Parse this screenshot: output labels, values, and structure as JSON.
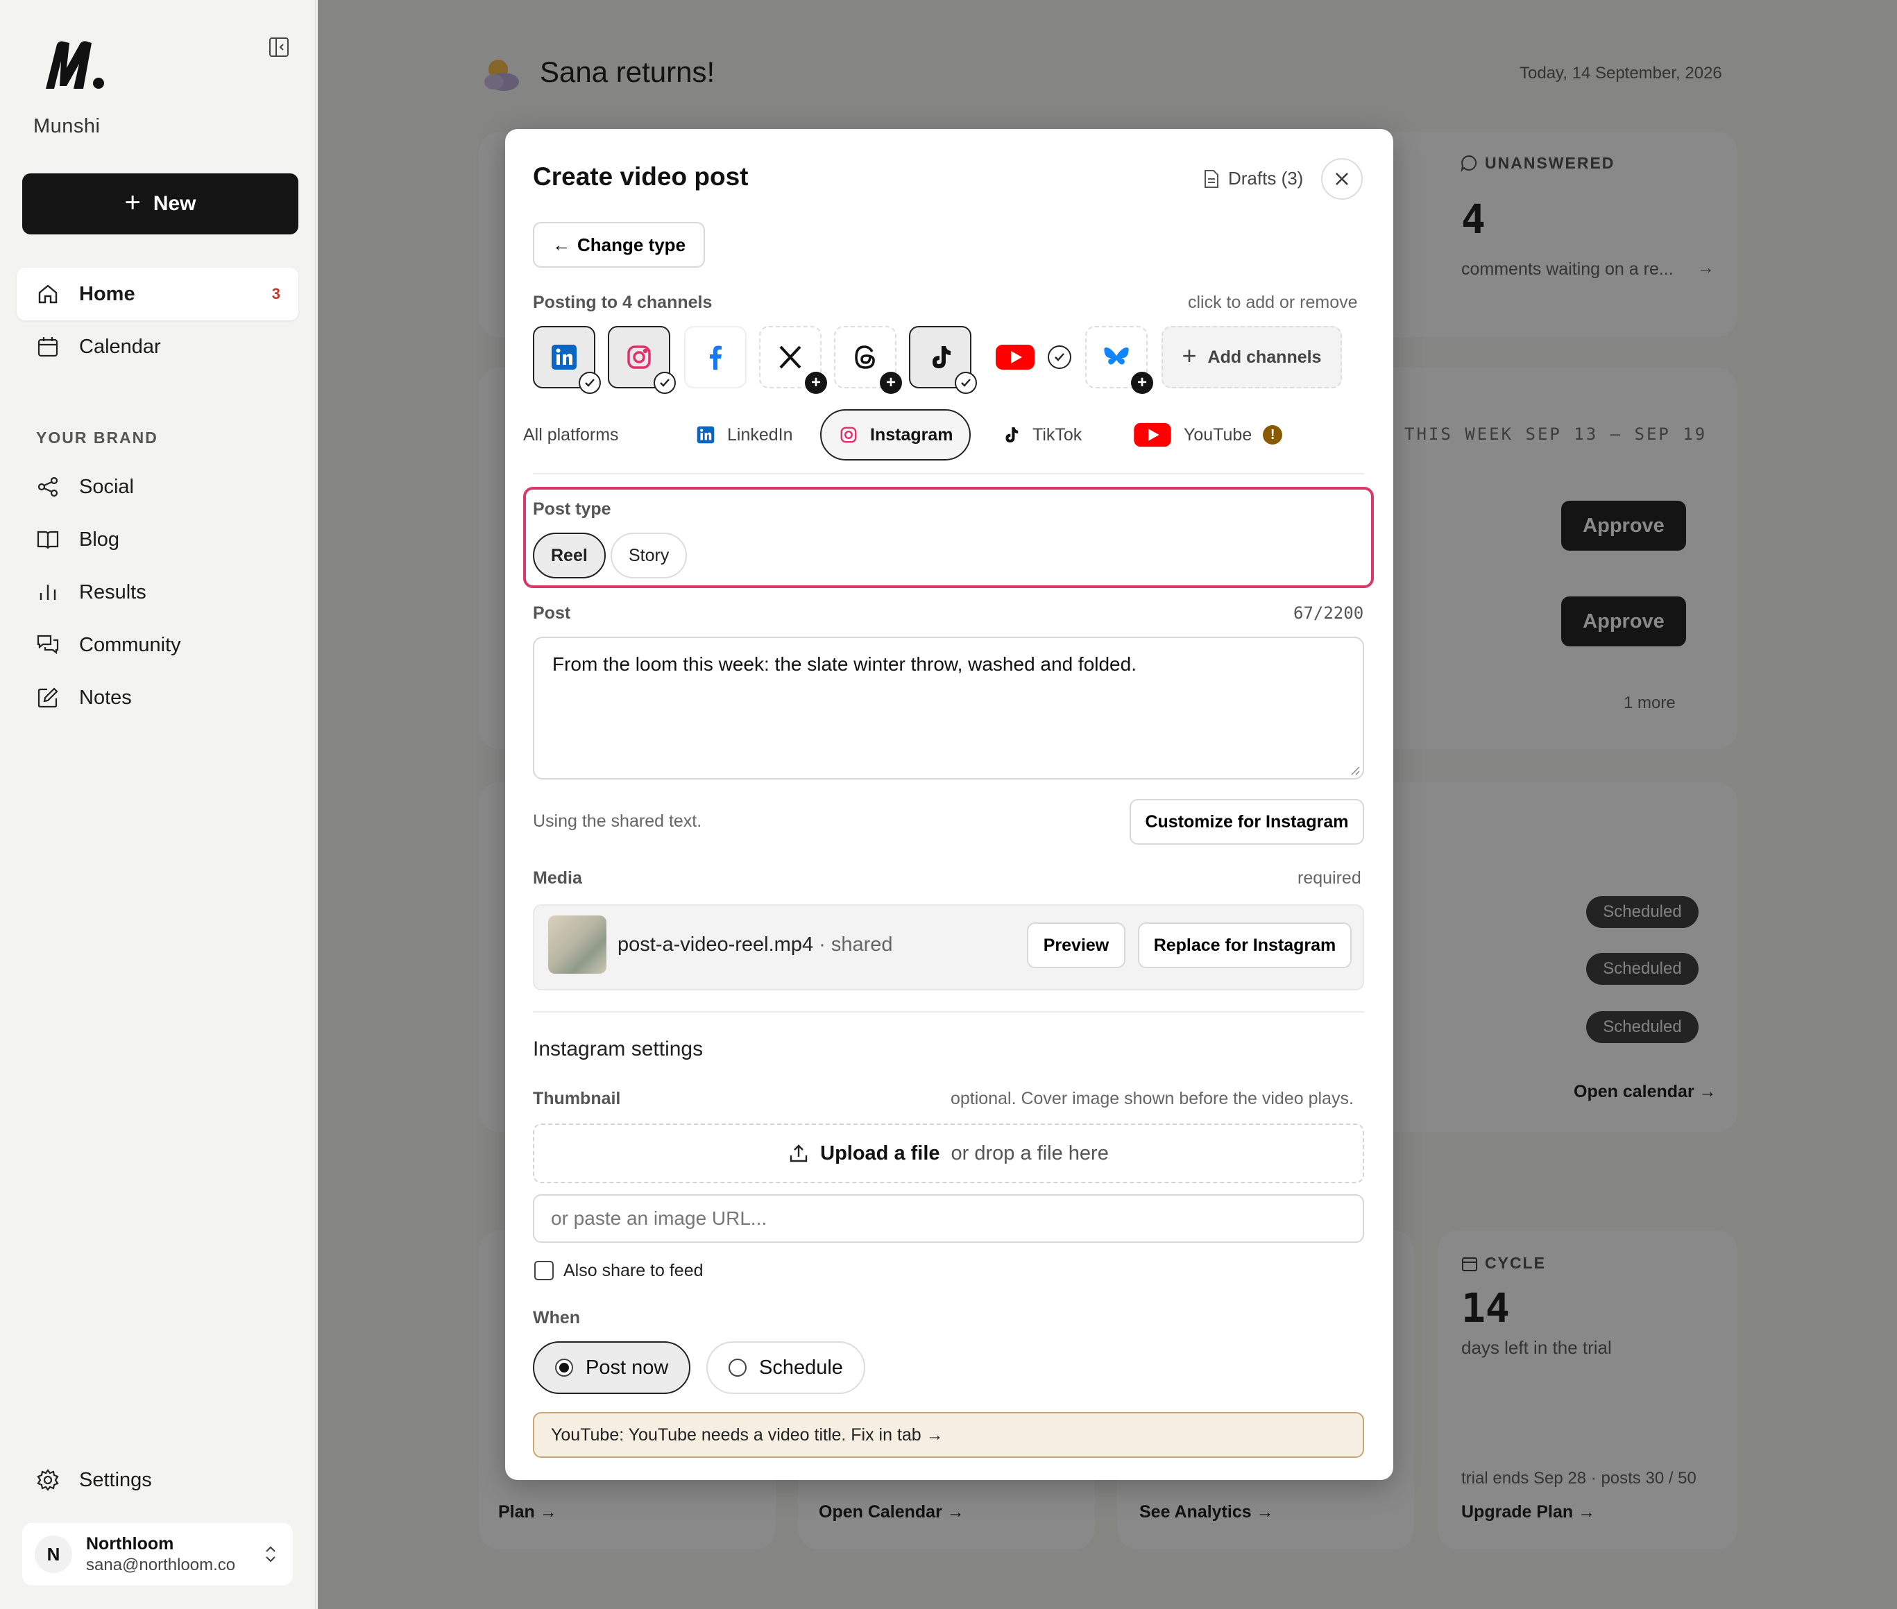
{
  "sidebar": {
    "brand": "Munshi",
    "new_label": "New",
    "nav": [
      {
        "label": "Home",
        "badge": "3"
      },
      {
        "label": "Calendar"
      }
    ],
    "section_label": "YOUR BRAND",
    "brand_nav": [
      {
        "label": "Social"
      },
      {
        "label": "Blog"
      },
      {
        "label": "Results"
      },
      {
        "label": "Community"
      },
      {
        "label": "Notes"
      }
    ],
    "settings_label": "Settings",
    "account": {
      "initial": "N",
      "name": "Northloom",
      "email": "sana@northloom.co"
    }
  },
  "dashboard": {
    "greeting": "Sana returns!",
    "date": "Today, 14 September, 2026",
    "unanswered_label": "UNANSWERED",
    "unanswered_count": "4",
    "unanswered_text": "comments waiting on a re...",
    "week_label": "THIS WEEK   SEP 13 – SEP 19",
    "approve_label": "Approve",
    "more_label": "1 more",
    "scheduled_label": "Scheduled",
    "open_calendar": "Open calendar →",
    "cycle_label": "CYCLE",
    "cycle_count": "14",
    "cycle_text": "days left in the trial",
    "trial_text": "trial ends Sep 28 · posts 30 / 50",
    "plan_link": "Plan →",
    "open_calendar_link": "Open Calendar →",
    "analytics_link": "See Analytics →",
    "upgrade_link": "Upgrade Plan →"
  },
  "modal": {
    "title": "Create video post",
    "drafts": "Drafts (3)",
    "change_type": "Change type",
    "posting_to": "Posting to 4 channels",
    "click_hint": "click to add or remove",
    "add_channels": "Add channels",
    "tabs": [
      "All platforms",
      "LinkedIn",
      "Instagram",
      "TikTok",
      "YouTube"
    ],
    "post_type_label": "Post type",
    "post_types": [
      "Reel",
      "Story"
    ],
    "post_label": "Post",
    "post_counter": "67/2200",
    "post_text": "From the loom this week: the slate winter throw, washed and folded.",
    "shared_text_note": "Using the shared text.",
    "customize_label": "Customize for Instagram",
    "media_label": "Media",
    "media_required": "required",
    "media_file": "post-a-video-reel.mp4",
    "media_shared": "· shared",
    "preview_label": "Preview",
    "replace_label": "Replace for Instagram",
    "settings_title": "Instagram settings",
    "thumbnail_label": "Thumbnail",
    "thumbnail_hint": "optional. Cover image shown before the video plays.",
    "upload_label": "Upload a file",
    "upload_hint": "or drop a file here",
    "url_placeholder": "or paste an image URL...",
    "share_feed_label": "Also share to feed",
    "when_label": "When",
    "post_now_label": "Post now",
    "schedule_label": "Schedule",
    "warning": "YouTube: YouTube needs a video title. Fix in tab →"
  },
  "colors": {
    "accent_highlight": "#d63a66",
    "primary_dark": "#141414",
    "linkedin": "#0a66c2",
    "instagram": "#e1306c",
    "facebook": "#1877f2",
    "youtube": "#ff0000",
    "bluesky": "#1185fe"
  }
}
